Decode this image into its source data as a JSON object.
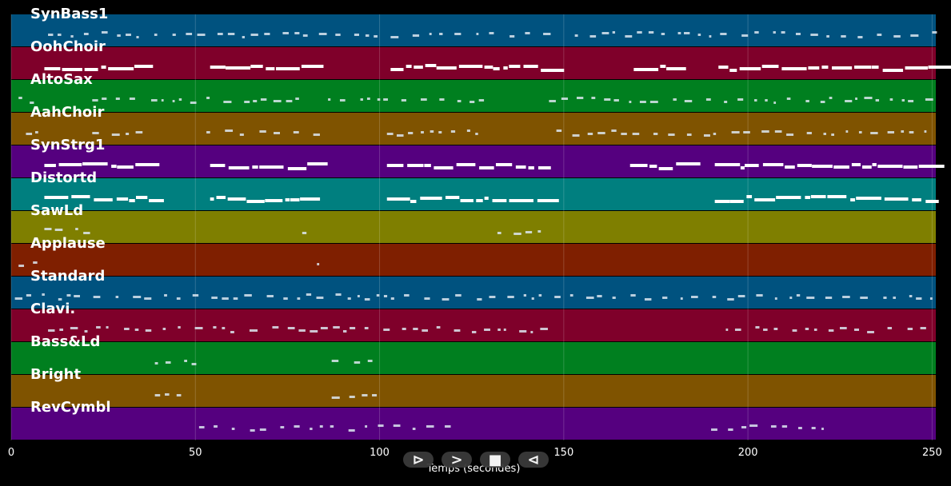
{
  "tracks": [
    {
      "name": "SynBass1",
      "color": "#00527f"
    },
    {
      "name": "OohChoir",
      "color": "#7f002a"
    },
    {
      "name": "AltoSax",
      "color": "#007f1f"
    },
    {
      "name": "AahChoir",
      "color": "#7f5300"
    },
    {
      "name": "SynStrg1",
      "color": "#55007f"
    },
    {
      "name": "Distortd",
      "color": "#007f7f"
    },
    {
      "name": "SawLd",
      "color": "#7f7f00"
    },
    {
      "name": "Applause",
      "color": "#7f1f00"
    },
    {
      "name": "Standard",
      "color": "#00527f"
    },
    {
      "name": "Clavi.",
      "color": "#7f002a"
    },
    {
      "name": "Bass&Ld",
      "color": "#007f1f"
    },
    {
      "name": "Bright",
      "color": "#7f5300"
    },
    {
      "name": "RevCymbl",
      "color": "#55007f"
    }
  ],
  "axis": {
    "xlabel": "Temps (secondes)",
    "xmin": 0,
    "xmax": 251,
    "ticks": [
      "0",
      "50",
      "100",
      "150",
      "200",
      "250"
    ],
    "tick_values": [
      0,
      50,
      100,
      150,
      200,
      250
    ]
  },
  "controls": {
    "play": "⊳",
    "forward": ">",
    "stop": "■",
    "rewind": "⊲"
  }
}
